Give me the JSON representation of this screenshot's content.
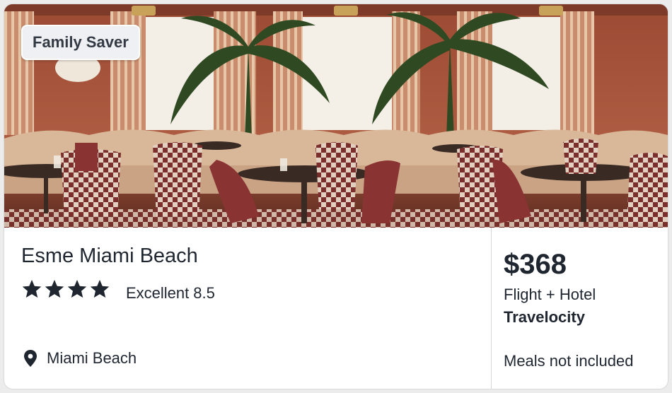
{
  "badge": {
    "label": "Family Saver"
  },
  "hotel": {
    "name": "Esme Miami Beach",
    "star_count": 4,
    "rating_label": "Excellent",
    "rating_score": "8.5",
    "location": "Miami Beach"
  },
  "offer": {
    "price": "$368",
    "package": "Flight + Hotel",
    "provider": "Travelocity",
    "meals": "Meals not included"
  },
  "colors": {
    "text": "#1f2630",
    "badge_bg": "#eef0f3",
    "divider": "#d6d6d6"
  },
  "icons": {
    "star": "star-icon",
    "location": "map-pin-icon"
  }
}
